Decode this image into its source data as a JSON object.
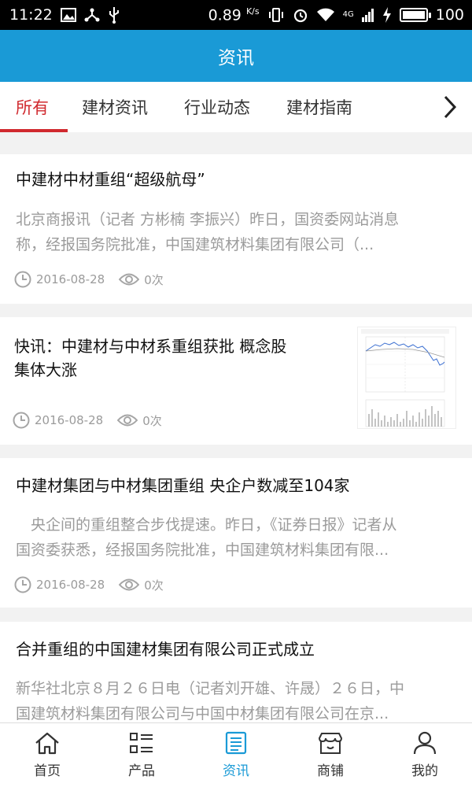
{
  "status_bar": {
    "time": "11:22",
    "net_speed": "0.89",
    "net_speed_unit": "K/s",
    "signal_type": "4G",
    "battery": "100"
  },
  "header": {
    "title": "资讯"
  },
  "tabs": [
    {
      "label": "所有",
      "active": true
    },
    {
      "label": "建材资讯",
      "active": false
    },
    {
      "label": "行业动态",
      "active": false
    },
    {
      "label": "建材指南",
      "active": false
    }
  ],
  "articles": [
    {
      "title": "中建材中材重组“超级航母”",
      "summary_line1": "北京商报讯（记者 方彬楠 李振兴）昨日，国资委网站消息",
      "summary_line2": "称，经报国务院批准，中国建筑材料集团有限公司（...",
      "date": "2016-08-28",
      "views": "0次"
    },
    {
      "title_line1": "快讯：中建材与中材系重组获批 概念股",
      "title_line2": "集体大涨",
      "date": "2016-08-28",
      "views": "0次",
      "has_thumbnail": true
    },
    {
      "title": "中建材集团与中材集团重组 央企户数减至104家",
      "summary_line1": "　央企间的重组整合步伐提速。昨日，《证券日报》记者从",
      "summary_line2": "国资委获悉，经报国务院批准，中国建筑材料集团有限...",
      "date": "2016-08-28",
      "views": "0次"
    },
    {
      "title": "合并重组的中国建材集团有限公司正式成立",
      "summary_line1": "新华社北京８月２６日电（记者刘开雄、许晟）２６日，中",
      "summary_line2": "国建筑材料集团有限公司与中国中材集团有限公司在京..."
    }
  ],
  "bottom_nav": [
    {
      "label": "首页",
      "icon": "home-icon"
    },
    {
      "label": "产品",
      "icon": "grid-list-icon"
    },
    {
      "label": "资讯",
      "icon": "news-icon",
      "active": true
    },
    {
      "label": "商铺",
      "icon": "shop-icon"
    },
    {
      "label": "我的",
      "icon": "user-icon"
    }
  ],
  "colors": {
    "accent": "#1a9ad6",
    "tab_active": "#d0292e",
    "muted": "#9b9b9b"
  }
}
